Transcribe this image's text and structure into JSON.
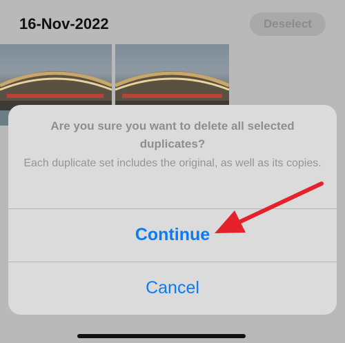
{
  "header": {
    "date": "16-Nov-2022",
    "deselect_label": "Deselect"
  },
  "alert": {
    "title": "Are you sure you want to delete all selected duplicates?",
    "message": "Each duplicate set includes the original, as well as its copies.",
    "continue_label": "Continue",
    "cancel_label": "Cancel"
  },
  "colors": {
    "accent": "#0a7bf3",
    "annotation_arrow": "#e5222b",
    "alert_background": "#dbdbdb"
  },
  "icons": {
    "annotation": "red-arrow-icon"
  }
}
